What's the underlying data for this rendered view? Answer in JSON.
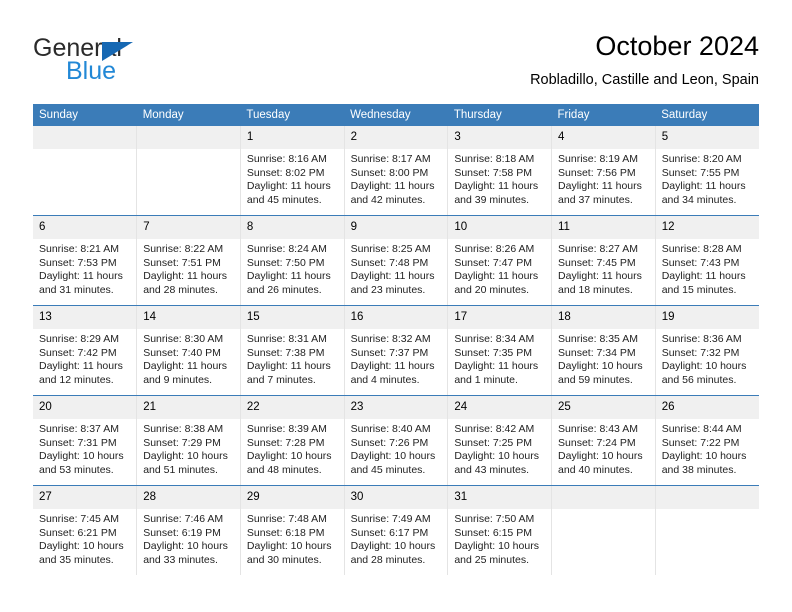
{
  "brand": {
    "name_part1": "General",
    "name_part2": "Blue",
    "triangle_icon": "triangle-icon",
    "accent_color": "#2288d6",
    "triangle_color": "#1668b3"
  },
  "header": {
    "title": "October 2024",
    "location": "Robladillo, Castille and Leon, Spain"
  },
  "calendar": {
    "header_bg": "#3b7cb8",
    "daynum_bg": "#f0f0f0",
    "row_border_color": "#3b7cb8",
    "weekday_headers": [
      "Sunday",
      "Monday",
      "Tuesday",
      "Wednesday",
      "Thursday",
      "Friday",
      "Saturday"
    ],
    "weeks": [
      [
        {
          "day": "",
          "sunrise": "",
          "sunset": "",
          "daylight": ""
        },
        {
          "day": "",
          "sunrise": "",
          "sunset": "",
          "daylight": ""
        },
        {
          "day": "1",
          "sunrise": "Sunrise: 8:16 AM",
          "sunset": "Sunset: 8:02 PM",
          "daylight": "Daylight: 11 hours and 45 minutes."
        },
        {
          "day": "2",
          "sunrise": "Sunrise: 8:17 AM",
          "sunset": "Sunset: 8:00 PM",
          "daylight": "Daylight: 11 hours and 42 minutes."
        },
        {
          "day": "3",
          "sunrise": "Sunrise: 8:18 AM",
          "sunset": "Sunset: 7:58 PM",
          "daylight": "Daylight: 11 hours and 39 minutes."
        },
        {
          "day": "4",
          "sunrise": "Sunrise: 8:19 AM",
          "sunset": "Sunset: 7:56 PM",
          "daylight": "Daylight: 11 hours and 37 minutes."
        },
        {
          "day": "5",
          "sunrise": "Sunrise: 8:20 AM",
          "sunset": "Sunset: 7:55 PM",
          "daylight": "Daylight: 11 hours and 34 minutes."
        }
      ],
      [
        {
          "day": "6",
          "sunrise": "Sunrise: 8:21 AM",
          "sunset": "Sunset: 7:53 PM",
          "daylight": "Daylight: 11 hours and 31 minutes."
        },
        {
          "day": "7",
          "sunrise": "Sunrise: 8:22 AM",
          "sunset": "Sunset: 7:51 PM",
          "daylight": "Daylight: 11 hours and 28 minutes."
        },
        {
          "day": "8",
          "sunrise": "Sunrise: 8:24 AM",
          "sunset": "Sunset: 7:50 PM",
          "daylight": "Daylight: 11 hours and 26 minutes."
        },
        {
          "day": "9",
          "sunrise": "Sunrise: 8:25 AM",
          "sunset": "Sunset: 7:48 PM",
          "daylight": "Daylight: 11 hours and 23 minutes."
        },
        {
          "day": "10",
          "sunrise": "Sunrise: 8:26 AM",
          "sunset": "Sunset: 7:47 PM",
          "daylight": "Daylight: 11 hours and 20 minutes."
        },
        {
          "day": "11",
          "sunrise": "Sunrise: 8:27 AM",
          "sunset": "Sunset: 7:45 PM",
          "daylight": "Daylight: 11 hours and 18 minutes."
        },
        {
          "day": "12",
          "sunrise": "Sunrise: 8:28 AM",
          "sunset": "Sunset: 7:43 PM",
          "daylight": "Daylight: 11 hours and 15 minutes."
        }
      ],
      [
        {
          "day": "13",
          "sunrise": "Sunrise: 8:29 AM",
          "sunset": "Sunset: 7:42 PM",
          "daylight": "Daylight: 11 hours and 12 minutes."
        },
        {
          "day": "14",
          "sunrise": "Sunrise: 8:30 AM",
          "sunset": "Sunset: 7:40 PM",
          "daylight": "Daylight: 11 hours and 9 minutes."
        },
        {
          "day": "15",
          "sunrise": "Sunrise: 8:31 AM",
          "sunset": "Sunset: 7:38 PM",
          "daylight": "Daylight: 11 hours and 7 minutes."
        },
        {
          "day": "16",
          "sunrise": "Sunrise: 8:32 AM",
          "sunset": "Sunset: 7:37 PM",
          "daylight": "Daylight: 11 hours and 4 minutes."
        },
        {
          "day": "17",
          "sunrise": "Sunrise: 8:34 AM",
          "sunset": "Sunset: 7:35 PM",
          "daylight": "Daylight: 11 hours and 1 minute."
        },
        {
          "day": "18",
          "sunrise": "Sunrise: 8:35 AM",
          "sunset": "Sunset: 7:34 PM",
          "daylight": "Daylight: 10 hours and 59 minutes."
        },
        {
          "day": "19",
          "sunrise": "Sunrise: 8:36 AM",
          "sunset": "Sunset: 7:32 PM",
          "daylight": "Daylight: 10 hours and 56 minutes."
        }
      ],
      [
        {
          "day": "20",
          "sunrise": "Sunrise: 8:37 AM",
          "sunset": "Sunset: 7:31 PM",
          "daylight": "Daylight: 10 hours and 53 minutes."
        },
        {
          "day": "21",
          "sunrise": "Sunrise: 8:38 AM",
          "sunset": "Sunset: 7:29 PM",
          "daylight": "Daylight: 10 hours and 51 minutes."
        },
        {
          "day": "22",
          "sunrise": "Sunrise: 8:39 AM",
          "sunset": "Sunset: 7:28 PM",
          "daylight": "Daylight: 10 hours and 48 minutes."
        },
        {
          "day": "23",
          "sunrise": "Sunrise: 8:40 AM",
          "sunset": "Sunset: 7:26 PM",
          "daylight": "Daylight: 10 hours and 45 minutes."
        },
        {
          "day": "24",
          "sunrise": "Sunrise: 8:42 AM",
          "sunset": "Sunset: 7:25 PM",
          "daylight": "Daylight: 10 hours and 43 minutes."
        },
        {
          "day": "25",
          "sunrise": "Sunrise: 8:43 AM",
          "sunset": "Sunset: 7:24 PM",
          "daylight": "Daylight: 10 hours and 40 minutes."
        },
        {
          "day": "26",
          "sunrise": "Sunrise: 8:44 AM",
          "sunset": "Sunset: 7:22 PM",
          "daylight": "Daylight: 10 hours and 38 minutes."
        }
      ],
      [
        {
          "day": "27",
          "sunrise": "Sunrise: 7:45 AM",
          "sunset": "Sunset: 6:21 PM",
          "daylight": "Daylight: 10 hours and 35 minutes."
        },
        {
          "day": "28",
          "sunrise": "Sunrise: 7:46 AM",
          "sunset": "Sunset: 6:19 PM",
          "daylight": "Daylight: 10 hours and 33 minutes."
        },
        {
          "day": "29",
          "sunrise": "Sunrise: 7:48 AM",
          "sunset": "Sunset: 6:18 PM",
          "daylight": "Daylight: 10 hours and 30 minutes."
        },
        {
          "day": "30",
          "sunrise": "Sunrise: 7:49 AM",
          "sunset": "Sunset: 6:17 PM",
          "daylight": "Daylight: 10 hours and 28 minutes."
        },
        {
          "day": "31",
          "sunrise": "Sunrise: 7:50 AM",
          "sunset": "Sunset: 6:15 PM",
          "daylight": "Daylight: 10 hours and 25 minutes."
        },
        {
          "day": "",
          "sunrise": "",
          "sunset": "",
          "daylight": ""
        },
        {
          "day": "",
          "sunrise": "",
          "sunset": "",
          "daylight": ""
        }
      ]
    ]
  }
}
